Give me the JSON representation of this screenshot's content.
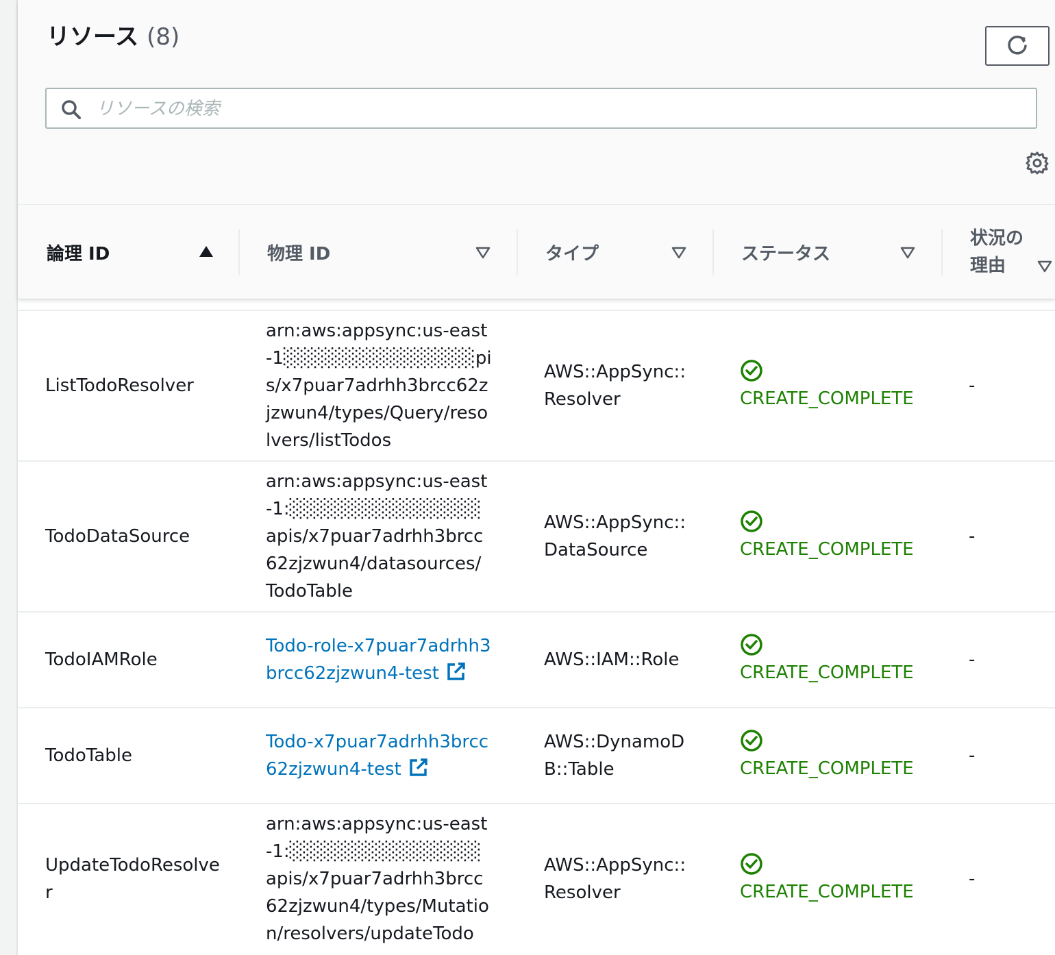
{
  "header": {
    "title": "リソース",
    "count": "(8)",
    "search_placeholder": "リソースの検索",
    "icons": {
      "search": "search-icon",
      "refresh": "refresh-icon",
      "settings": "gear-icon"
    }
  },
  "columns": {
    "logical_id": "論理 ID",
    "physical_id": "物理 ID",
    "type": "タイプ",
    "status": "ステータス",
    "reason_line1": "状況の",
    "reason_line2": "理由"
  },
  "colors": {
    "link": "#0073bb",
    "success": "#1d8102",
    "border": "#eaeded",
    "header_bg": "#fafafa"
  },
  "rows": [
    {
      "logical_id": "ListTodoResolver",
      "physical_id": "arn:aws:appsync:us-east-1░░░░░░░░░░░░░░pis/x7puar7adrhh3brcc62zjzwun4/types/Query/resolvers/listTodos",
      "physical_is_link": false,
      "type": "AWS::AppSync::Resolver",
      "status": "CREATE_COMPLETE",
      "reason": "-"
    },
    {
      "logical_id": "TodoDataSource",
      "physical_id": "arn:aws:appsync:us-east-1:░░░░░░░░░░░░░░apis/x7puar7adrhh3brcc62zjzwun4/datasources/TodoTable",
      "physical_is_link": false,
      "type": "AWS::AppSync::DataSource",
      "status": "CREATE_COMPLETE",
      "reason": "-"
    },
    {
      "logical_id": "TodoIAMRole",
      "physical_id": "Todo-role-x7puar7adrhh3brcc62zjzwun4-test",
      "physical_is_link": true,
      "type": "AWS::IAM::Role",
      "status": "CREATE_COMPLETE",
      "reason": "-"
    },
    {
      "logical_id": "TodoTable",
      "physical_id": "Todo-x7puar7adrhh3brcc62zjzwun4-test",
      "physical_is_link": true,
      "type": "AWS::DynamoDB::Table",
      "status": "CREATE_COMPLETE",
      "reason": "-"
    },
    {
      "logical_id": "UpdateTodoResolver",
      "physical_id": "arn:aws:appsync:us-east-1:░░░░░░░░░░░░░░apis/x7puar7adrhh3brcc62zjzwun4/types/Mutation/resolvers/updateTodo",
      "physical_is_link": false,
      "type": "AWS::AppSync::Resolver",
      "status": "CREATE_COMPLETE",
      "reason": "-"
    }
  ]
}
